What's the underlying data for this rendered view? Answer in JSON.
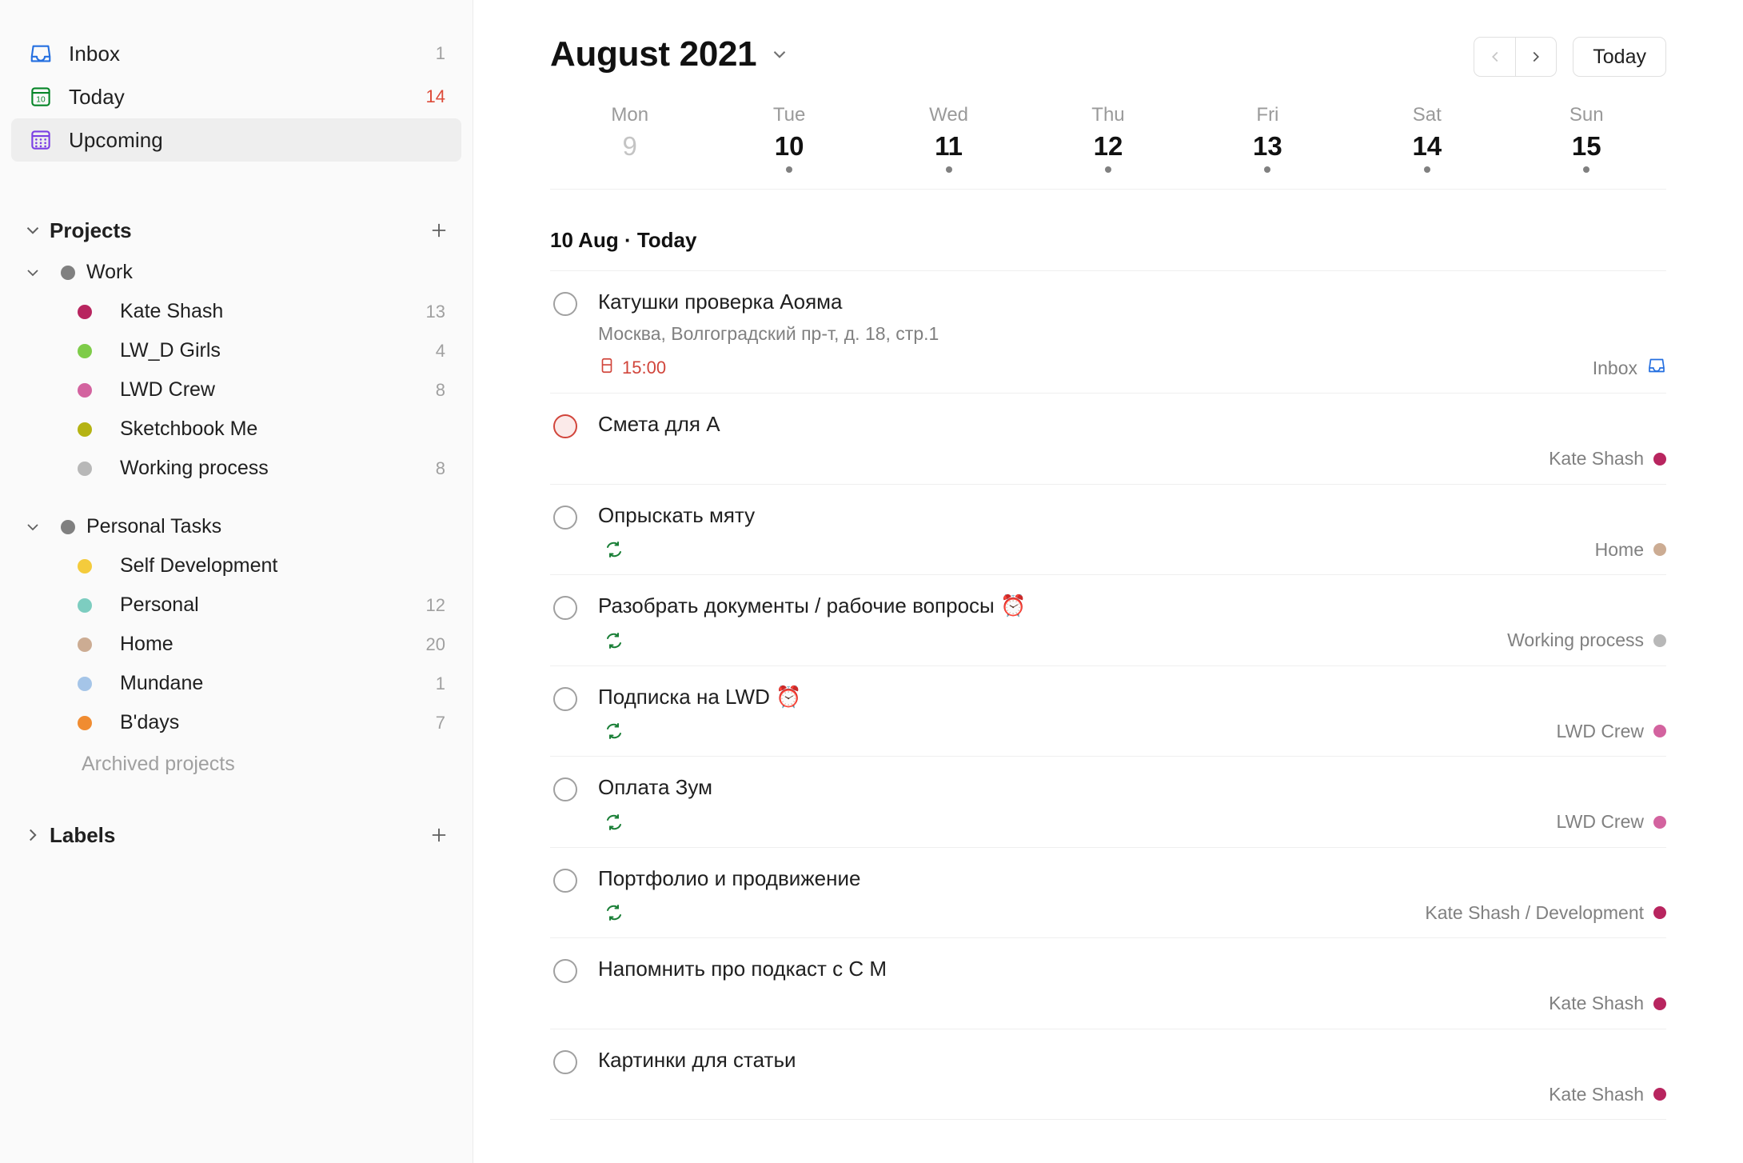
{
  "sidebar": {
    "nav": [
      {
        "label": "Inbox",
        "count": "1",
        "icon": "inbox-icon",
        "active": false,
        "accent": false
      },
      {
        "label": "Today",
        "count": "14",
        "icon": "calendar-today-icon",
        "active": false,
        "accent": true
      },
      {
        "label": "Upcoming",
        "count": "",
        "icon": "calendar-upcoming-icon",
        "active": true,
        "accent": false
      }
    ],
    "projects_section": {
      "title": "Projects",
      "add_label": "+",
      "expanded": true
    },
    "labels_section": {
      "title": "Labels",
      "add_label": "+",
      "expanded": false
    },
    "archived_label": "Archived projects",
    "groups": [
      {
        "name": "Work",
        "color": "#808080",
        "count": "",
        "items": [
          {
            "label": "Kate Shash",
            "color": "#b8255f",
            "count": "13"
          },
          {
            "label": "LW_D Girls",
            "color": "#7ecc49",
            "count": "4"
          },
          {
            "label": "LWD Crew",
            "color": "#d3639f",
            "count": "8"
          },
          {
            "label": "Sketchbook Me",
            "color": "#b5b313",
            "count": ""
          },
          {
            "label": "Working process",
            "color": "#b8b8b8",
            "count": "8"
          }
        ]
      },
      {
        "name": "Personal Tasks",
        "color": "#808080",
        "count": "",
        "items": [
          {
            "label": "Self Development",
            "color": "#f4cb3c",
            "count": ""
          },
          {
            "label": "Personal",
            "color": "#7dcdc0",
            "count": "12"
          },
          {
            "label": "Home",
            "color": "#ccac93",
            "count": "20"
          },
          {
            "label": "Mundane",
            "color": "#a5c5e8",
            "count": "1"
          },
          {
            "label": "B'days",
            "color": "#f08c31",
            "count": "7"
          }
        ]
      }
    ]
  },
  "header": {
    "title": "August 2021",
    "prev_label": "‹",
    "next_label": "›",
    "today_label": "Today"
  },
  "week": [
    {
      "dayname": "Mon",
      "daynum": "9",
      "past": true,
      "dot": false
    },
    {
      "dayname": "Tue",
      "daynum": "10",
      "past": false,
      "dot": true
    },
    {
      "dayname": "Wed",
      "daynum": "11",
      "past": false,
      "dot": true
    },
    {
      "dayname": "Thu",
      "daynum": "12",
      "past": false,
      "dot": true
    },
    {
      "dayname": "Fri",
      "daynum": "13",
      "past": false,
      "dot": true
    },
    {
      "dayname": "Sat",
      "daynum": "14",
      "past": false,
      "dot": true
    },
    {
      "dayname": "Sun",
      "daynum": "15",
      "past": false,
      "dot": true
    }
  ],
  "day_header": "10 Aug · Today",
  "tasks": [
    {
      "title": "Катушки проверка Аояма",
      "desc": "Москва, Волгоградский пр-т, д. 18, стр.1",
      "due": "15:00",
      "recurring": false,
      "priority": "normal",
      "project": "Inbox",
      "project_color": "",
      "project_icon": "inbox-icon",
      "emoji": ""
    },
    {
      "title": "Смета для А",
      "desc": "",
      "due": "",
      "recurring": false,
      "priority": "p1",
      "project": "Kate Shash",
      "project_color": "#b8255f",
      "project_icon": "",
      "emoji": ""
    },
    {
      "title": "Опрыскать мяту",
      "desc": "",
      "due": "",
      "recurring": true,
      "priority": "normal",
      "project": "Home",
      "project_color": "#ccac93",
      "project_icon": "",
      "emoji": ""
    },
    {
      "title": "Разобрать документы / рабочие вопросы",
      "desc": "",
      "due": "",
      "recurring": true,
      "priority": "normal",
      "project": "Working process",
      "project_color": "#b8b8b8",
      "project_icon": "",
      "emoji": "⏰"
    },
    {
      "title": "Подписка на LWD",
      "desc": "",
      "due": "",
      "recurring": true,
      "priority": "normal",
      "project": "LWD Crew",
      "project_color": "#d3639f",
      "project_icon": "",
      "emoji": "⏰"
    },
    {
      "title": "Оплата Зум",
      "desc": "",
      "due": "",
      "recurring": true,
      "priority": "normal",
      "project": "LWD Crew",
      "project_color": "#d3639f",
      "project_icon": "",
      "emoji": ""
    },
    {
      "title": "Портфолио и продвижение",
      "desc": "",
      "due": "",
      "recurring": true,
      "priority": "normal",
      "project": "Kate Shash / Development",
      "project_color": "#b8255f",
      "project_icon": "",
      "emoji": ""
    },
    {
      "title": "Напомнить про подкаст с С М",
      "desc": "",
      "due": "",
      "recurring": false,
      "priority": "normal",
      "project": "Kate Shash",
      "project_color": "#b8255f",
      "project_icon": "",
      "emoji": ""
    },
    {
      "title": "Картинки для статьи",
      "desc": "",
      "due": "",
      "recurring": false,
      "priority": "normal",
      "project": "Kate Shash",
      "project_color": "#b8255f",
      "project_icon": "",
      "emoji": ""
    }
  ],
  "colors": {
    "accent_red": "#d1453b",
    "inbox_blue": "#246fe0",
    "upcoming_purple": "#7b3fe4",
    "today_green": "#058527",
    "recur_green": "#1a7f37"
  }
}
